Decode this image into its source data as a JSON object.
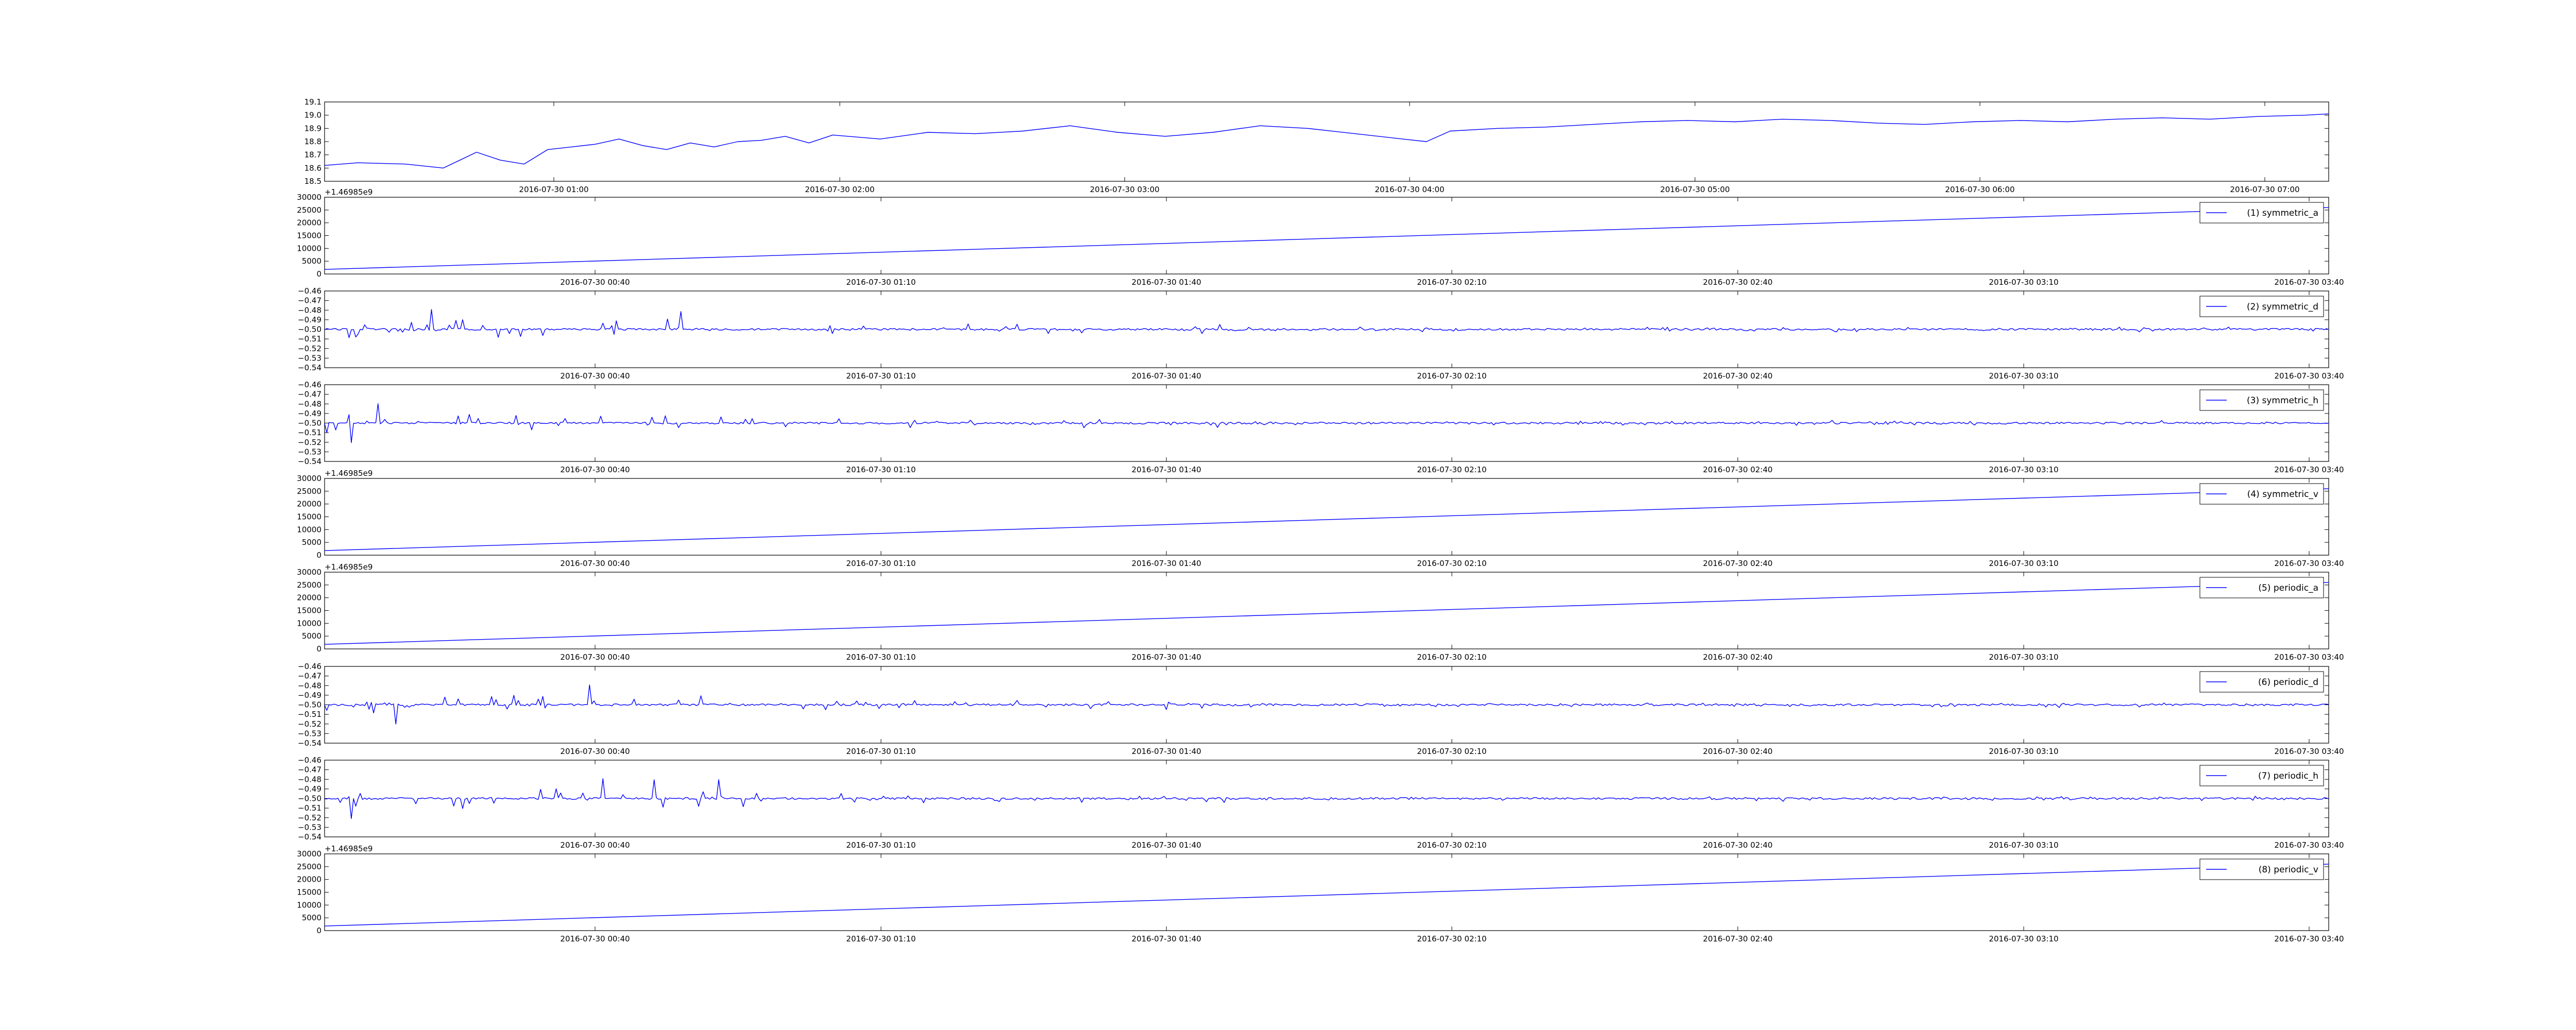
{
  "colors": {
    "series": "#0000ff",
    "frame": "#000000",
    "background": "#ffffff"
  },
  "chart_data": [
    {
      "type": "line",
      "ylim": [
        18.5,
        19.1
      ],
      "yticks": [
        "18.5",
        "18.6",
        "18.7",
        "18.8",
        "18.9",
        "19.0",
        "19.1"
      ],
      "xticks": [
        "2016-07-30 01:00",
        "2016-07-30 02:00",
        "2016-07-30 03:00",
        "2016-07-30 04:00",
        "2016-07-30 05:00",
        "2016-07-30 06:00",
        "2016-07-30 07:00"
      ],
      "x_start": "2016-07-30 00:13",
      "x_end": "2016-07-30 07:15",
      "series": [
        {
          "x": [
            "00:13",
            "00:20",
            "00:30",
            "00:38",
            "00:45",
            "00:50",
            "00:55",
            "01:00",
            "01:05",
            "01:10",
            "01:15",
            "01:20",
            "01:25",
            "01:30",
            "01:35",
            "01:40",
            "01:45",
            "01:50",
            "01:55",
            "02:00",
            "02:10",
            "02:20",
            "02:30",
            "02:40",
            "02:50",
            "03:00",
            "03:10",
            "03:20",
            "03:30",
            "03:40",
            "03:50",
            "04:00",
            "04:05",
            "04:10",
            "04:20",
            "04:30",
            "04:40",
            "04:50",
            "05:00",
            "05:10",
            "05:20",
            "05:30",
            "05:40",
            "05:50",
            "06:00",
            "06:10",
            "06:20",
            "06:30",
            "06:40",
            "06:50",
            "07:00",
            "07:10",
            "07:15"
          ],
          "values": [
            18.62,
            18.64,
            18.63,
            18.6,
            18.72,
            18.66,
            18.63,
            18.74,
            18.76,
            18.78,
            18.82,
            18.77,
            18.74,
            18.79,
            18.76,
            18.8,
            18.81,
            18.84,
            18.79,
            18.85,
            18.82,
            18.87,
            18.86,
            18.88,
            18.92,
            18.87,
            18.84,
            18.87,
            18.92,
            18.9,
            18.86,
            18.82,
            18.8,
            18.88,
            18.9,
            18.91,
            18.93,
            18.95,
            18.96,
            18.95,
            18.97,
            18.96,
            18.94,
            18.93,
            18.95,
            18.96,
            18.95,
            18.97,
            18.98,
            18.97,
            18.99,
            19.0,
            19.01
          ]
        }
      ]
    },
    {
      "type": "line",
      "ylim": [
        0,
        30000
      ],
      "yticks": [
        "0",
        "5000",
        "10000",
        "15000",
        "20000",
        "25000",
        "30000"
      ],
      "xticks": [
        "2016-07-30 00:40",
        "2016-07-30 01:10",
        "2016-07-30 01:40",
        "2016-07-30 02:10",
        "2016-07-30 02:40",
        "2016-07-30 03:10",
        "2016-07-30 03:40"
      ],
      "offset": "+1.46985e9",
      "series": [
        {
          "name": "(1) symmetric_a",
          "x": [
            "2016-07-30 00:15",
            "2016-07-30 03:40"
          ],
          "values": [
            1800,
            26000
          ]
        }
      ]
    },
    {
      "type": "line",
      "ylim": [
        -0.54,
        -0.46
      ],
      "yticks": [
        "−0.54",
        "−0.53",
        "−0.52",
        "−0.51",
        "−0.50",
        "−0.49",
        "−0.48",
        "−0.47",
        "−0.46"
      ],
      "xticks": [
        "2016-07-30 00:40",
        "2016-07-30 01:10",
        "2016-07-30 01:40",
        "2016-07-30 02:10",
        "2016-07-30 02:40",
        "2016-07-30 03:10",
        "2016-07-30 03:40"
      ],
      "series": [
        {
          "name": "(2) symmetric_d",
          "baseline": -0.5
        }
      ]
    },
    {
      "type": "line",
      "ylim": [
        -0.54,
        -0.46
      ],
      "yticks": [
        "−0.54",
        "−0.53",
        "−0.52",
        "−0.51",
        "−0.50",
        "−0.49",
        "−0.48",
        "−0.47",
        "−0.46"
      ],
      "xticks": [
        "2016-07-30 00:40",
        "2016-07-30 01:10",
        "2016-07-30 01:40",
        "2016-07-30 02:10",
        "2016-07-30 02:40",
        "2016-07-30 03:10",
        "2016-07-30 03:40"
      ],
      "series": [
        {
          "name": "(3) symmetric_h",
          "baseline": -0.5
        }
      ]
    },
    {
      "type": "line",
      "ylim": [
        0,
        30000
      ],
      "yticks": [
        "0",
        "5000",
        "10000",
        "15000",
        "20000",
        "25000",
        "30000"
      ],
      "xticks": [
        "2016-07-30 00:40",
        "2016-07-30 01:10",
        "2016-07-30 01:40",
        "2016-07-30 02:10",
        "2016-07-30 02:40",
        "2016-07-30 03:10",
        "2016-07-30 03:40"
      ],
      "offset": "+1.46985e9",
      "series": [
        {
          "name": "(4) symmetric_v",
          "x": [
            "2016-07-30 00:15",
            "2016-07-30 03:40"
          ],
          "values": [
            1800,
            26000
          ]
        }
      ]
    },
    {
      "type": "line",
      "ylim": [
        0,
        30000
      ],
      "yticks": [
        "0",
        "5000",
        "10000",
        "15000",
        "20000",
        "25000",
        "30000"
      ],
      "xticks": [
        "2016-07-30 00:40",
        "2016-07-30 01:10",
        "2016-07-30 01:40",
        "2016-07-30 02:10",
        "2016-07-30 02:40",
        "2016-07-30 03:10",
        "2016-07-30 03:40"
      ],
      "offset": "+1.46985e9",
      "series": [
        {
          "name": "(5) periodic_a",
          "x": [
            "2016-07-30 00:15",
            "2016-07-30 03:40"
          ],
          "values": [
            1800,
            26000
          ]
        }
      ]
    },
    {
      "type": "line",
      "ylim": [
        -0.54,
        -0.46
      ],
      "yticks": [
        "−0.54",
        "−0.53",
        "−0.52",
        "−0.51",
        "−0.50",
        "−0.49",
        "−0.48",
        "−0.47",
        "−0.46"
      ],
      "xticks": [
        "2016-07-30 00:40",
        "2016-07-30 01:10",
        "2016-07-30 01:40",
        "2016-07-30 02:10",
        "2016-07-30 02:40",
        "2016-07-30 03:10",
        "2016-07-30 03:40"
      ],
      "series": [
        {
          "name": "(6) periodic_d",
          "baseline": -0.5
        }
      ]
    },
    {
      "type": "line",
      "ylim": [
        -0.54,
        -0.46
      ],
      "yticks": [
        "−0.54",
        "−0.53",
        "−0.52",
        "−0.51",
        "−0.50",
        "−0.49",
        "−0.48",
        "−0.47",
        "−0.46"
      ],
      "xticks": [
        "2016-07-30 00:40",
        "2016-07-30 01:10",
        "2016-07-30 01:40",
        "2016-07-30 02:10",
        "2016-07-30 02:40",
        "2016-07-30 03:10",
        "2016-07-30 03:40"
      ],
      "series": [
        {
          "name": "(7) periodic_h",
          "baseline": -0.5
        }
      ]
    },
    {
      "type": "line",
      "ylim": [
        0,
        30000
      ],
      "yticks": [
        "0",
        "5000",
        "10000",
        "15000",
        "20000",
        "25000",
        "30000"
      ],
      "xticks": [
        "2016-07-30 00:40",
        "2016-07-30 01:10",
        "2016-07-30 01:40",
        "2016-07-30 02:10",
        "2016-07-30 02:40",
        "2016-07-30 03:10",
        "2016-07-30 03:40"
      ],
      "offset": "+1.46985e9",
      "series": [
        {
          "name": "(8) periodic_v",
          "x": [
            "2016-07-30 00:15",
            "2016-07-30 03:40"
          ],
          "values": [
            1800,
            26000
          ]
        }
      ]
    }
  ]
}
